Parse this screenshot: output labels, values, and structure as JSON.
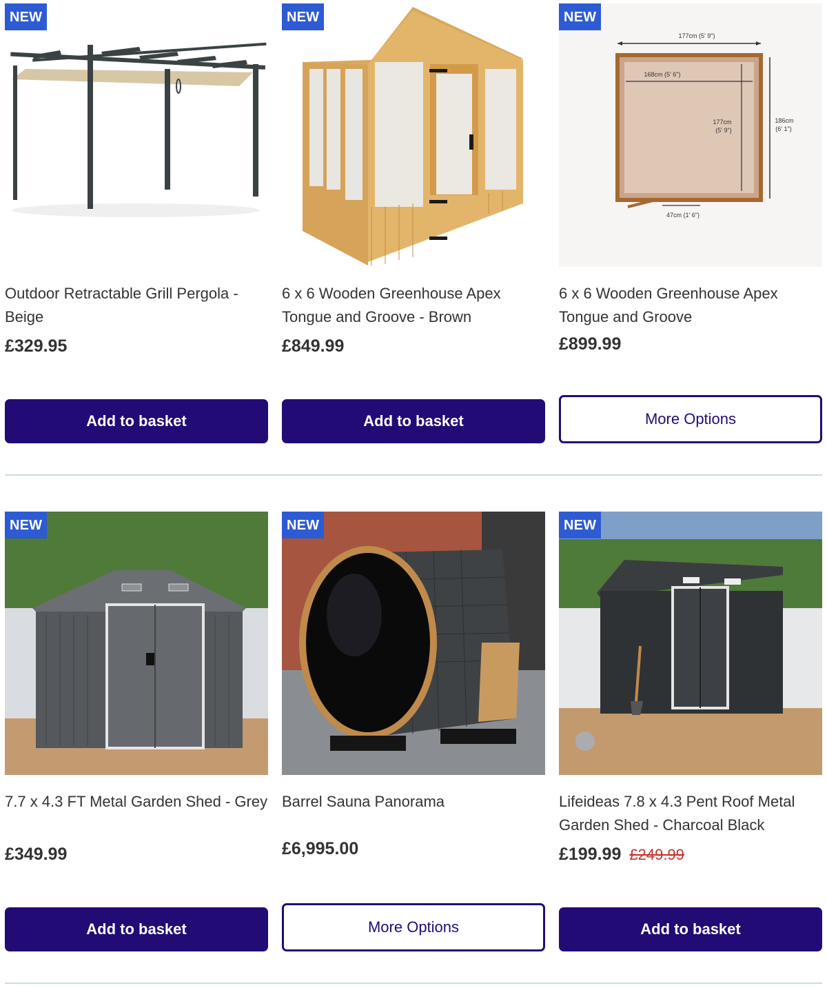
{
  "products": [
    {
      "badge": "NEW",
      "title": "Outdoor Retractable Grill Pergola - Beige",
      "price": "£329.95",
      "was_price": "",
      "button": "Add to basket",
      "button_style": "primary",
      "image_icon": "pergola-image"
    },
    {
      "badge": "NEW",
      "title": "6 x 6 Wooden Greenhouse Apex Tongue and Groove - Brown",
      "price": "£849.99",
      "was_price": "",
      "button": "Add to basket",
      "button_style": "primary",
      "image_icon": "greenhouse-image"
    },
    {
      "badge": "NEW",
      "title": "6 x 6 Wooden Greenhouse Apex Tongue and Groove",
      "price": "£899.99",
      "was_price": "",
      "button": "More Options",
      "button_style": "outline",
      "image_icon": "floor-plan-image",
      "dimensions": {
        "top_width": "177cm (5' 9\")",
        "inner_width": "168cm (5' 6\")",
        "inner_depth": "177cm",
        "inner_depth_ft": "(5' 9\")",
        "outer_depth": "186cm",
        "outer_depth_ft": "(6' 1\")",
        "door": "47cm (1' 6\")"
      }
    },
    {
      "badge": "NEW",
      "title": "7.7 x 4.3 FT Metal Garden Shed - Grey",
      "price": "£349.99",
      "was_price": "",
      "button": "Add to basket",
      "button_style": "primary",
      "image_icon": "metal-shed-image"
    },
    {
      "badge": "NEW",
      "title": "Barrel Sauna Panorama",
      "price": "£6,995.00",
      "was_price": "",
      "button": "More Options",
      "button_style": "outline",
      "image_icon": "barrel-sauna-image"
    },
    {
      "badge": "NEW",
      "title": "Lifeideas 7.8 x 4.3 Pent Roof Metal Garden Shed - Charcoal Black",
      "price": "£199.99",
      "was_price": "£249.99",
      "button": "Add to basket",
      "button_style": "primary",
      "image_icon": "pent-shed-image"
    }
  ],
  "colors": {
    "badge": "#2d5bd3",
    "button_primary": "#230b75",
    "was_price": "#c8302c",
    "divider": "#c9dde3"
  }
}
